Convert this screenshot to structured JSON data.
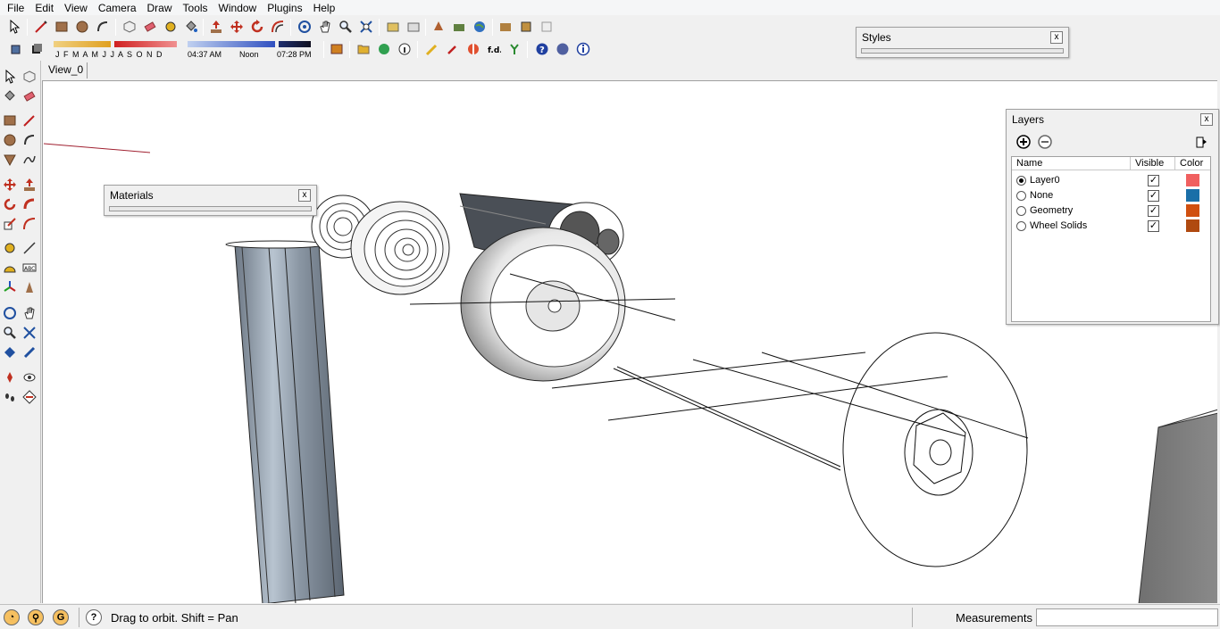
{
  "menu": [
    "File",
    "Edit",
    "View",
    "Camera",
    "Draw",
    "Tools",
    "Window",
    "Plugins",
    "Help"
  ],
  "shadow_bar": {
    "months": "J F M A M J J A S O N D",
    "time_start": "04:37 AM",
    "time_mid": "Noon",
    "time_end": "07:28 PM"
  },
  "tabs": [
    "View_0"
  ],
  "styles_panel": {
    "title": "Styles",
    "close": "x"
  },
  "materials_panel": {
    "title": "Materials",
    "close": "x"
  },
  "layers_panel": {
    "title": "Layers",
    "close": "x",
    "columns": {
      "name": "Name",
      "visible": "Visible",
      "color": "Color"
    },
    "rows": [
      {
        "name": "Layer0",
        "active": true,
        "visible": true,
        "color": "#f06060"
      },
      {
        "name": "None",
        "active": false,
        "visible": true,
        "color": "#1a6fa8"
      },
      {
        "name": "Geometry",
        "active": false,
        "visible": true,
        "color": "#d05010"
      },
      {
        "name": "Wheel Solids",
        "active": false,
        "visible": true,
        "color": "#b04a10"
      }
    ]
  },
  "status": {
    "help_icon": "?",
    "message": "Drag to orbit.  Shift = Pan",
    "measurements_label": "Measurements",
    "measurements_value": ""
  },
  "colors": {
    "viewport_bg": "#ffffff",
    "chrome_bg": "#f0f0f0"
  }
}
